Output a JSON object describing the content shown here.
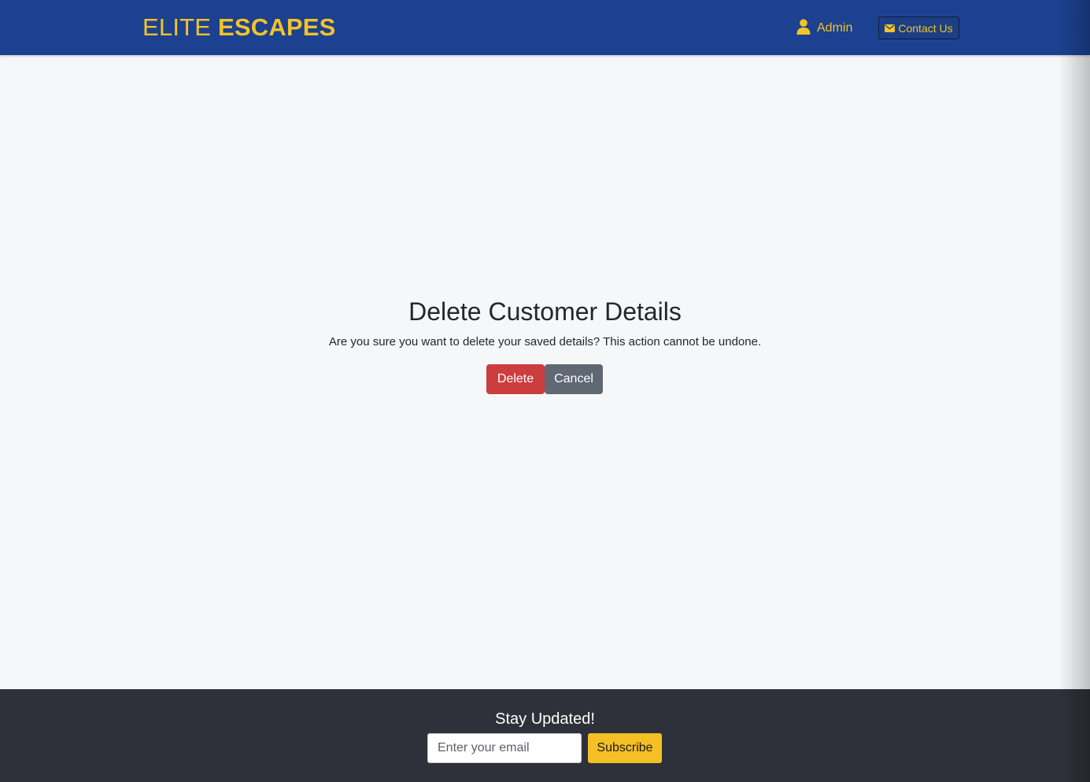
{
  "navbar": {
    "brand_part1": "ELITE",
    "brand_part2": "ESCAPES",
    "admin_label": "Admin",
    "admin_icon": "user-icon",
    "contact_label": "Contact Us",
    "contact_icon": "envelope-icon",
    "background_color": "#1b4190",
    "accent_color": "#f4c329"
  },
  "main": {
    "title": "Delete Customer Details",
    "message": "Are you sure you want to delete your saved details? This action cannot be undone.",
    "delete_label": "Delete",
    "cancel_label": "Cancel",
    "delete_color": "#cc3d40",
    "cancel_color": "#606873"
  },
  "footer": {
    "title": "Stay Updated!",
    "email_placeholder": "Enter your email",
    "email_value": "",
    "subscribe_label": "Subscribe",
    "background_color": "#2e3139",
    "subscribe_color": "#f4c025"
  }
}
